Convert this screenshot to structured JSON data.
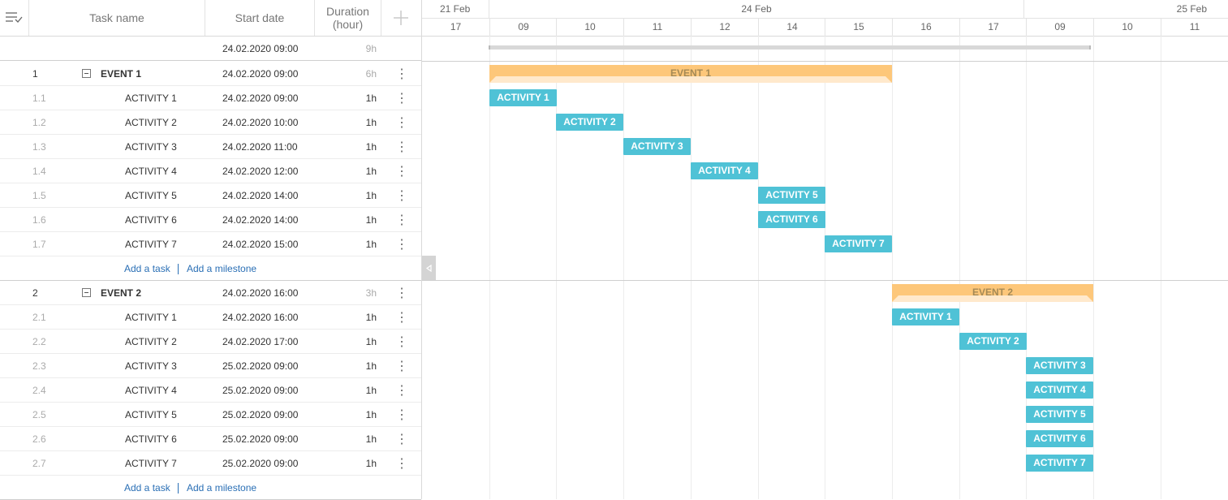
{
  "grid": {
    "headers": {
      "task_name": "Task name",
      "start_date": "Start date",
      "duration": "Duration\n(hour)"
    },
    "summary": {
      "start": "24.02.2020 09:00",
      "duration": "9h"
    },
    "groups": [
      {
        "num": "1",
        "name": "EVENT 1",
        "start": "24.02.2020 09:00",
        "duration": "6h",
        "tasks": [
          {
            "num": "1.1",
            "name": "ACTIVITY 1",
            "start": "24.02.2020 09:00",
            "duration": "1h"
          },
          {
            "num": "1.2",
            "name": "ACTIVITY 2",
            "start": "24.02.2020 10:00",
            "duration": "1h"
          },
          {
            "num": "1.3",
            "name": "ACTIVITY 3",
            "start": "24.02.2020 11:00",
            "duration": "1h"
          },
          {
            "num": "1.4",
            "name": "ACTIVITY 4",
            "start": "24.02.2020 12:00",
            "duration": "1h"
          },
          {
            "num": "1.5",
            "name": "ACTIVITY 5",
            "start": "24.02.2020 14:00",
            "duration": "1h"
          },
          {
            "num": "1.6",
            "name": "ACTIVITY 6",
            "start": "24.02.2020 14:00",
            "duration": "1h"
          },
          {
            "num": "1.7",
            "name": "ACTIVITY 7",
            "start": "24.02.2020 15:00",
            "duration": "1h"
          }
        ]
      },
      {
        "num": "2",
        "name": "EVENT 2",
        "start": "24.02.2020 16:00",
        "duration": "3h",
        "tasks": [
          {
            "num": "2.1",
            "name": "ACTIVITY 1",
            "start": "24.02.2020 16:00",
            "duration": "1h"
          },
          {
            "num": "2.2",
            "name": "ACTIVITY 2",
            "start": "24.02.2020 17:00",
            "duration": "1h"
          },
          {
            "num": "2.3",
            "name": "ACTIVITY 3",
            "start": "25.02.2020 09:00",
            "duration": "1h"
          },
          {
            "num": "2.4",
            "name": "ACTIVITY 4",
            "start": "25.02.2020 09:00",
            "duration": "1h"
          },
          {
            "num": "2.5",
            "name": "ACTIVITY 5",
            "start": "25.02.2020 09:00",
            "duration": "1h"
          },
          {
            "num": "2.6",
            "name": "ACTIVITY 6",
            "start": "25.02.2020 09:00",
            "duration": "1h"
          },
          {
            "num": "2.7",
            "name": "ACTIVITY 7",
            "start": "25.02.2020 09:00",
            "duration": "1h"
          }
        ]
      }
    ],
    "add_task": "Add a task",
    "add_milestone": "Add a milestone"
  },
  "timeline": {
    "days": [
      "21 Feb",
      "24 Feb",
      "25 Feb"
    ],
    "hours": [
      "17",
      "09",
      "10",
      "11",
      "12",
      "14",
      "15",
      "16",
      "17",
      "09",
      "10",
      "11"
    ]
  },
  "colors": {
    "task_bar": "#4fc2d6",
    "event_bar": "#fdc77a",
    "event_bar_light": "#ffe9cc",
    "link": "#2a6fb5"
  }
}
